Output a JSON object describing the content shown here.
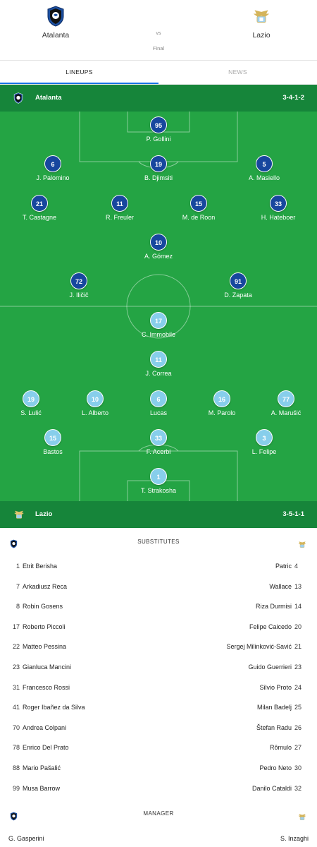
{
  "match": {
    "home_team": "Atalanta",
    "away_team": "Lazio",
    "vs": "vs",
    "status": "Final"
  },
  "tabs": [
    {
      "label": "LINEUPS",
      "active": true
    },
    {
      "label": "NEWS",
      "active": false
    }
  ],
  "home_bar": {
    "name": "Atalanta",
    "formation": "3-4-1-2"
  },
  "away_bar": {
    "name": "Lazio",
    "formation": "3-5-1-1"
  },
  "home_players": [
    {
      "number": "95",
      "name": "P. Gollini"
    },
    {
      "number": "6",
      "name": "J. Palomino"
    },
    {
      "number": "19",
      "name": "B. Djimsiti"
    },
    {
      "number": "5",
      "name": "A. Masiello"
    },
    {
      "number": "21",
      "name": "T. Castagne"
    },
    {
      "number": "11",
      "name": "R. Freuler"
    },
    {
      "number": "15",
      "name": "M. de Roon"
    },
    {
      "number": "33",
      "name": "H. Hateboer"
    },
    {
      "number": "10",
      "name": "A. Gómez"
    },
    {
      "number": "72",
      "name": "J. Iličič"
    },
    {
      "number": "91",
      "name": "D. Zapata"
    }
  ],
  "away_players": [
    {
      "number": "17",
      "name": "C. Immobile"
    },
    {
      "number": "11",
      "name": "J. Correa"
    },
    {
      "number": "19",
      "name": "S. Lulić"
    },
    {
      "number": "10",
      "name": "L. Alberto"
    },
    {
      "number": "6",
      "name": "Lucas"
    },
    {
      "number": "16",
      "name": "M. Parolo"
    },
    {
      "number": "77",
      "name": "A. Marušić"
    },
    {
      "number": "15",
      "name": "Bastos"
    },
    {
      "number": "33",
      "name": "F. Acerbi"
    },
    {
      "number": "3",
      "name": "L. Felipe"
    },
    {
      "number": "1",
      "name": "T. Strakosha"
    }
  ],
  "substitutes": {
    "title": "SUBSTITUTES",
    "rows": [
      {
        "home_num": "1",
        "home_name": "Etrit Berisha",
        "away_name": "Patric",
        "away_num": "4"
      },
      {
        "home_num": "7",
        "home_name": "Arkadiusz Reca",
        "away_name": "Wallace",
        "away_num": "13"
      },
      {
        "home_num": "8",
        "home_name": "Robin Gosens",
        "away_name": "Riza Durmisi",
        "away_num": "14"
      },
      {
        "home_num": "17",
        "home_name": "Roberto Piccoli",
        "away_name": "Felipe Caicedo",
        "away_num": "20"
      },
      {
        "home_num": "22",
        "home_name": "Matteo Pessina",
        "away_name": "Sergej Milinković-Savić",
        "away_num": "21"
      },
      {
        "home_num": "23",
        "home_name": "Gianluca Mancini",
        "away_name": "Guido Guerrieri",
        "away_num": "23"
      },
      {
        "home_num": "31",
        "home_name": "Francesco Rossi",
        "away_name": "Silvio Proto",
        "away_num": "24"
      },
      {
        "home_num": "41",
        "home_name": "Roger Ibañez da Silva",
        "away_name": "Milan Badelj",
        "away_num": "25"
      },
      {
        "home_num": "70",
        "home_name": "Andrea Colpani",
        "away_name": "Štefan Radu",
        "away_num": "26"
      },
      {
        "home_num": "78",
        "home_name": "Enrico Del Prato",
        "away_name": "Rômulo",
        "away_num": "27"
      },
      {
        "home_num": "88",
        "home_name": "Mario Pašalić",
        "away_name": "Pedro Neto",
        "away_num": "30"
      },
      {
        "home_num": "99",
        "home_name": "Musa Barrow",
        "away_name": "Danilo Cataldi",
        "away_num": "32"
      }
    ]
  },
  "manager": {
    "title": "MANAGER",
    "home": "G. Gasperini",
    "away": "S. Inzaghi"
  },
  "colors": {
    "team_bar": "#16853a",
    "pitch": "#24a444",
    "home_disc": "#17479e",
    "away_disc": "#87ceeb",
    "tab_underline": "#1a73e8"
  },
  "icons": {
    "home_crest": "atalanta-crest-icon",
    "away_crest": "lazio-eagle-crest-icon"
  }
}
